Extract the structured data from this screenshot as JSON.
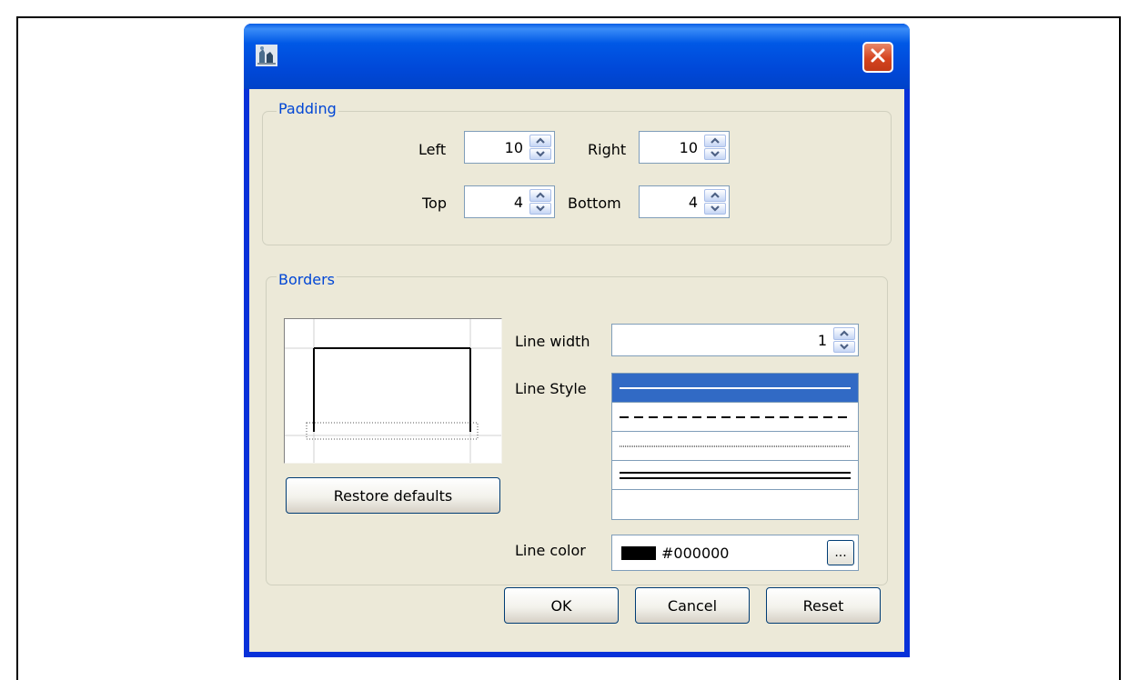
{
  "dialog": {
    "icon": "java-app-icon",
    "close_icon": "close-icon"
  },
  "padding": {
    "legend": "Padding",
    "left_label": "Left",
    "left_value": "10",
    "right_label": "Right",
    "right_value": "10",
    "top_label": "Top",
    "top_value": "4",
    "bottom_label": "Bottom",
    "bottom_value": "4"
  },
  "borders": {
    "legend": "Borders",
    "restore_defaults": "Restore defaults",
    "line_width_label": "Line width",
    "line_width_value": "1",
    "line_style_label": "Line Style",
    "line_styles": [
      "solid",
      "dashed",
      "dotted",
      "double",
      "none"
    ],
    "selected_line_style": "solid",
    "line_color_label": "Line color",
    "line_color_value": "#000000",
    "color_button_label": "..."
  },
  "buttons": {
    "ok": "OK",
    "cancel": "Cancel",
    "reset": "Reset"
  },
  "colors": {
    "titlebar": "#0054e3",
    "legend_text": "#0046d5",
    "selection": "#316ac5",
    "dialog_bg": "#ece9d8"
  }
}
